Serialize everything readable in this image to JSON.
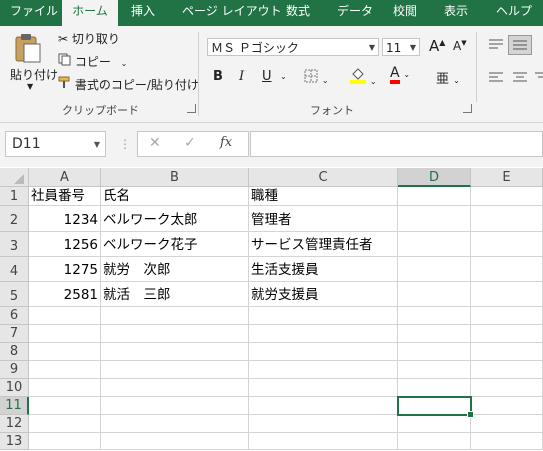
{
  "tabs": [
    {
      "label": "ファイル",
      "active": false
    },
    {
      "label": "ホーム",
      "active": true
    },
    {
      "label": "挿入",
      "active": false
    },
    {
      "label": "ページ レイアウト",
      "active": false
    },
    {
      "label": "数式",
      "active": false
    },
    {
      "label": "データ",
      "active": false
    },
    {
      "label": "校閲",
      "active": false
    },
    {
      "label": "表示",
      "active": false
    },
    {
      "label": "ヘルプ",
      "active": false
    }
  ],
  "ribbon": {
    "clipboard": {
      "paste_label": "貼り付け",
      "cut_label": "切り取り",
      "copy_label": "コピー",
      "format_painter_label": "書式のコピー/貼り付け",
      "group_label": "クリップボード"
    },
    "font": {
      "font_name": "ＭＳ Ｐゴシック",
      "font_size": "11",
      "bold": "B",
      "italic": "I",
      "underline": "U",
      "increase": "A",
      "decrease": "A",
      "font_color_glyph": "A",
      "highlight_color": "#ffff00",
      "font_color": "#ff0000",
      "group_label": "フォント"
    }
  },
  "formula_bar": {
    "name_box": "D11",
    "fx": "fx",
    "formula": ""
  },
  "columns": [
    "A",
    "B",
    "C",
    "D",
    "E"
  ],
  "selected_column": "D",
  "rows": [
    "1",
    "2",
    "3",
    "4",
    "5",
    "6",
    "7",
    "8",
    "9",
    "10",
    "11",
    "12",
    "13"
  ],
  "selected_row": "11",
  "cells": {
    "A1": "社員番号",
    "B1": "氏名",
    "C1": "職種",
    "A2": "1234",
    "B2": "ベルワーク太郎",
    "C2": "管理者",
    "A3": "1256",
    "B3": "ベルワーク花子",
    "C3": "サービス管理責任者",
    "A4": "1275",
    "B4": "就労　次郎",
    "C4": "生活支援員",
    "A5": "2581",
    "B5": "就活　三郎",
    "C5": "就労支援員"
  },
  "theme": {
    "accent": "#217346"
  }
}
